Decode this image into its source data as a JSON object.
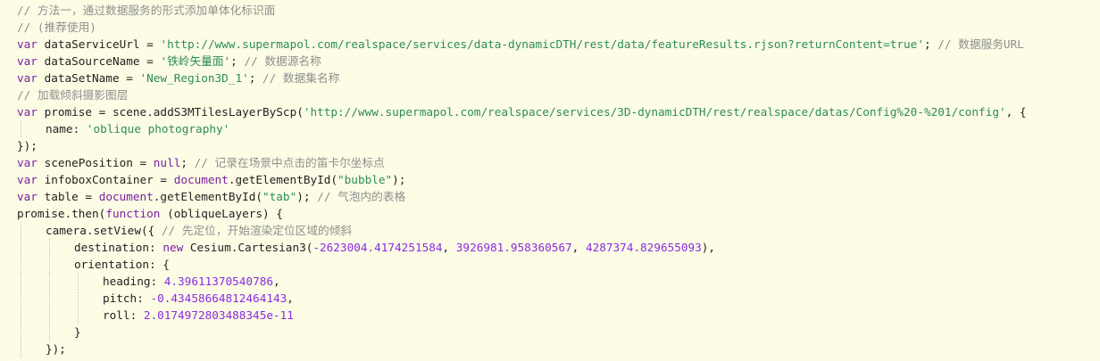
{
  "editor": {
    "lines": [
      {
        "indent": 0,
        "tokens": [
          {
            "t": "cmt",
            "v": "// 方法一，通过数据服务的形式添加单体化标识面"
          }
        ]
      },
      {
        "indent": 0,
        "tokens": [
          {
            "t": "cmt",
            "v": "// (推荐使用)"
          }
        ]
      },
      {
        "indent": 0,
        "tokens": [
          {
            "t": "kw",
            "v": "var"
          },
          {
            "t": "pl",
            "v": " "
          },
          {
            "t": "id",
            "v": "dataServiceUrl"
          },
          {
            "t": "pl",
            "v": " = "
          },
          {
            "t": "str",
            "v": "'http://www.supermapol.com/realspace/services/data-dynamicDTH/rest/data/featureResults.rjson?returnContent=true'"
          },
          {
            "t": "pl",
            "v": "; "
          },
          {
            "t": "cmt",
            "v": "// 数据服务URL"
          }
        ]
      },
      {
        "indent": 0,
        "tokens": [
          {
            "t": "kw",
            "v": "var"
          },
          {
            "t": "pl",
            "v": " "
          },
          {
            "t": "id",
            "v": "dataSourceName"
          },
          {
            "t": "pl",
            "v": " = "
          },
          {
            "t": "str",
            "v": "'铁岭矢量面'"
          },
          {
            "t": "pl",
            "v": "; "
          },
          {
            "t": "cmt",
            "v": "// 数据源名称"
          }
        ]
      },
      {
        "indent": 0,
        "tokens": [
          {
            "t": "kw",
            "v": "var"
          },
          {
            "t": "pl",
            "v": " "
          },
          {
            "t": "id",
            "v": "dataSetName"
          },
          {
            "t": "pl",
            "v": " = "
          },
          {
            "t": "str",
            "v": "'New_Region3D_1'"
          },
          {
            "t": "pl",
            "v": "; "
          },
          {
            "t": "cmt",
            "v": "// 数据集名称"
          }
        ]
      },
      {
        "indent": 0,
        "tokens": [
          {
            "t": "cmt",
            "v": "// 加载倾斜摄影图层"
          }
        ]
      },
      {
        "indent": 0,
        "tokens": [
          {
            "t": "kw",
            "v": "var"
          },
          {
            "t": "pl",
            "v": " "
          },
          {
            "t": "id",
            "v": "promise"
          },
          {
            "t": "pl",
            "v": " = scene.addS3MTilesLayerByScp("
          },
          {
            "t": "str",
            "v": "'http://www.supermapol.com/realspace/services/3D-dynamicDTH/rest/realspace/datas/Config%20-%201/config'"
          },
          {
            "t": "pl",
            "v": ", {"
          }
        ]
      },
      {
        "indent": 1,
        "tokens": [
          {
            "t": "id",
            "v": "name"
          },
          {
            "t": "pl",
            "v": ": "
          },
          {
            "t": "str",
            "v": "'oblique photography'"
          }
        ]
      },
      {
        "indent": 0,
        "tokens": [
          {
            "t": "pl",
            "v": "});"
          }
        ]
      },
      {
        "indent": 0,
        "tokens": [
          {
            "t": "kw",
            "v": "var"
          },
          {
            "t": "pl",
            "v": " "
          },
          {
            "t": "id",
            "v": "scenePosition"
          },
          {
            "t": "pl",
            "v": " = "
          },
          {
            "t": "kw",
            "v": "null"
          },
          {
            "t": "pl",
            "v": "; "
          },
          {
            "t": "cmt",
            "v": "// 记录在场景中点击的笛卡尔坐标点"
          }
        ]
      },
      {
        "indent": 0,
        "tokens": [
          {
            "t": "kw",
            "v": "var"
          },
          {
            "t": "pl",
            "v": " "
          },
          {
            "t": "id",
            "v": "infoboxContainer"
          },
          {
            "t": "pl",
            "v": " = "
          },
          {
            "t": "kw",
            "v": "document"
          },
          {
            "t": "pl",
            "v": ".getElementById("
          },
          {
            "t": "str",
            "v": "\"bubble\""
          },
          {
            "t": "pl",
            "v": ");"
          }
        ]
      },
      {
        "indent": 0,
        "tokens": [
          {
            "t": "kw",
            "v": "var"
          },
          {
            "t": "pl",
            "v": " "
          },
          {
            "t": "id",
            "v": "table"
          },
          {
            "t": "pl",
            "v": " = "
          },
          {
            "t": "kw",
            "v": "document"
          },
          {
            "t": "pl",
            "v": ".getElementById("
          },
          {
            "t": "str",
            "v": "\"tab\""
          },
          {
            "t": "pl",
            "v": "); "
          },
          {
            "t": "cmt",
            "v": "// 气泡内的表格"
          }
        ]
      },
      {
        "indent": 0,
        "tokens": [
          {
            "t": "id",
            "v": "promise"
          },
          {
            "t": "pl",
            "v": ".then("
          },
          {
            "t": "kw",
            "v": "function"
          },
          {
            "t": "pl",
            "v": " (obliqueLayers) {"
          }
        ]
      },
      {
        "indent": 1,
        "tokens": [
          {
            "t": "id",
            "v": "camera"
          },
          {
            "t": "pl",
            "v": ".setView({ "
          },
          {
            "t": "cmt",
            "v": "// 先定位，开始渲染定位区域的倾斜"
          }
        ]
      },
      {
        "indent": 2,
        "tokens": [
          {
            "t": "id",
            "v": "destination"
          },
          {
            "t": "pl",
            "v": ": "
          },
          {
            "t": "kw",
            "v": "new"
          },
          {
            "t": "pl",
            "v": " Cesium.Cartesian3("
          },
          {
            "t": "num",
            "v": "-2623004.4174251584"
          },
          {
            "t": "pl",
            "v": ", "
          },
          {
            "t": "num",
            "v": "3926981.958360567"
          },
          {
            "t": "pl",
            "v": ", "
          },
          {
            "t": "num",
            "v": "4287374.829655093"
          },
          {
            "t": "pl",
            "v": "),"
          }
        ]
      },
      {
        "indent": 2,
        "tokens": [
          {
            "t": "id",
            "v": "orientation"
          },
          {
            "t": "pl",
            "v": ": {"
          }
        ]
      },
      {
        "indent": 3,
        "tokens": [
          {
            "t": "id",
            "v": "heading"
          },
          {
            "t": "pl",
            "v": ": "
          },
          {
            "t": "num",
            "v": "4.39611370540786"
          },
          {
            "t": "pl",
            "v": ","
          }
        ]
      },
      {
        "indent": 3,
        "tokens": [
          {
            "t": "id",
            "v": "pitch"
          },
          {
            "t": "pl",
            "v": ": "
          },
          {
            "t": "num",
            "v": "-0.43458664812464143"
          },
          {
            "t": "pl",
            "v": ","
          }
        ]
      },
      {
        "indent": 3,
        "tokens": [
          {
            "t": "id",
            "v": "roll"
          },
          {
            "t": "pl",
            "v": ": "
          },
          {
            "t": "num",
            "v": "2.0174972803488345e-11"
          }
        ]
      },
      {
        "indent": 2,
        "tokens": [
          {
            "t": "pl",
            "v": "}"
          }
        ]
      },
      {
        "indent": 1,
        "tokens": [
          {
            "t": "pl",
            "v": "});"
          }
        ]
      }
    ]
  },
  "colors": {
    "background": "#fdfde6",
    "keyword": "#7a1fa2",
    "string": "#2e8b57",
    "comment": "#8e8e8e",
    "number": "#8a2be2",
    "plain": "#1f1f1f"
  }
}
